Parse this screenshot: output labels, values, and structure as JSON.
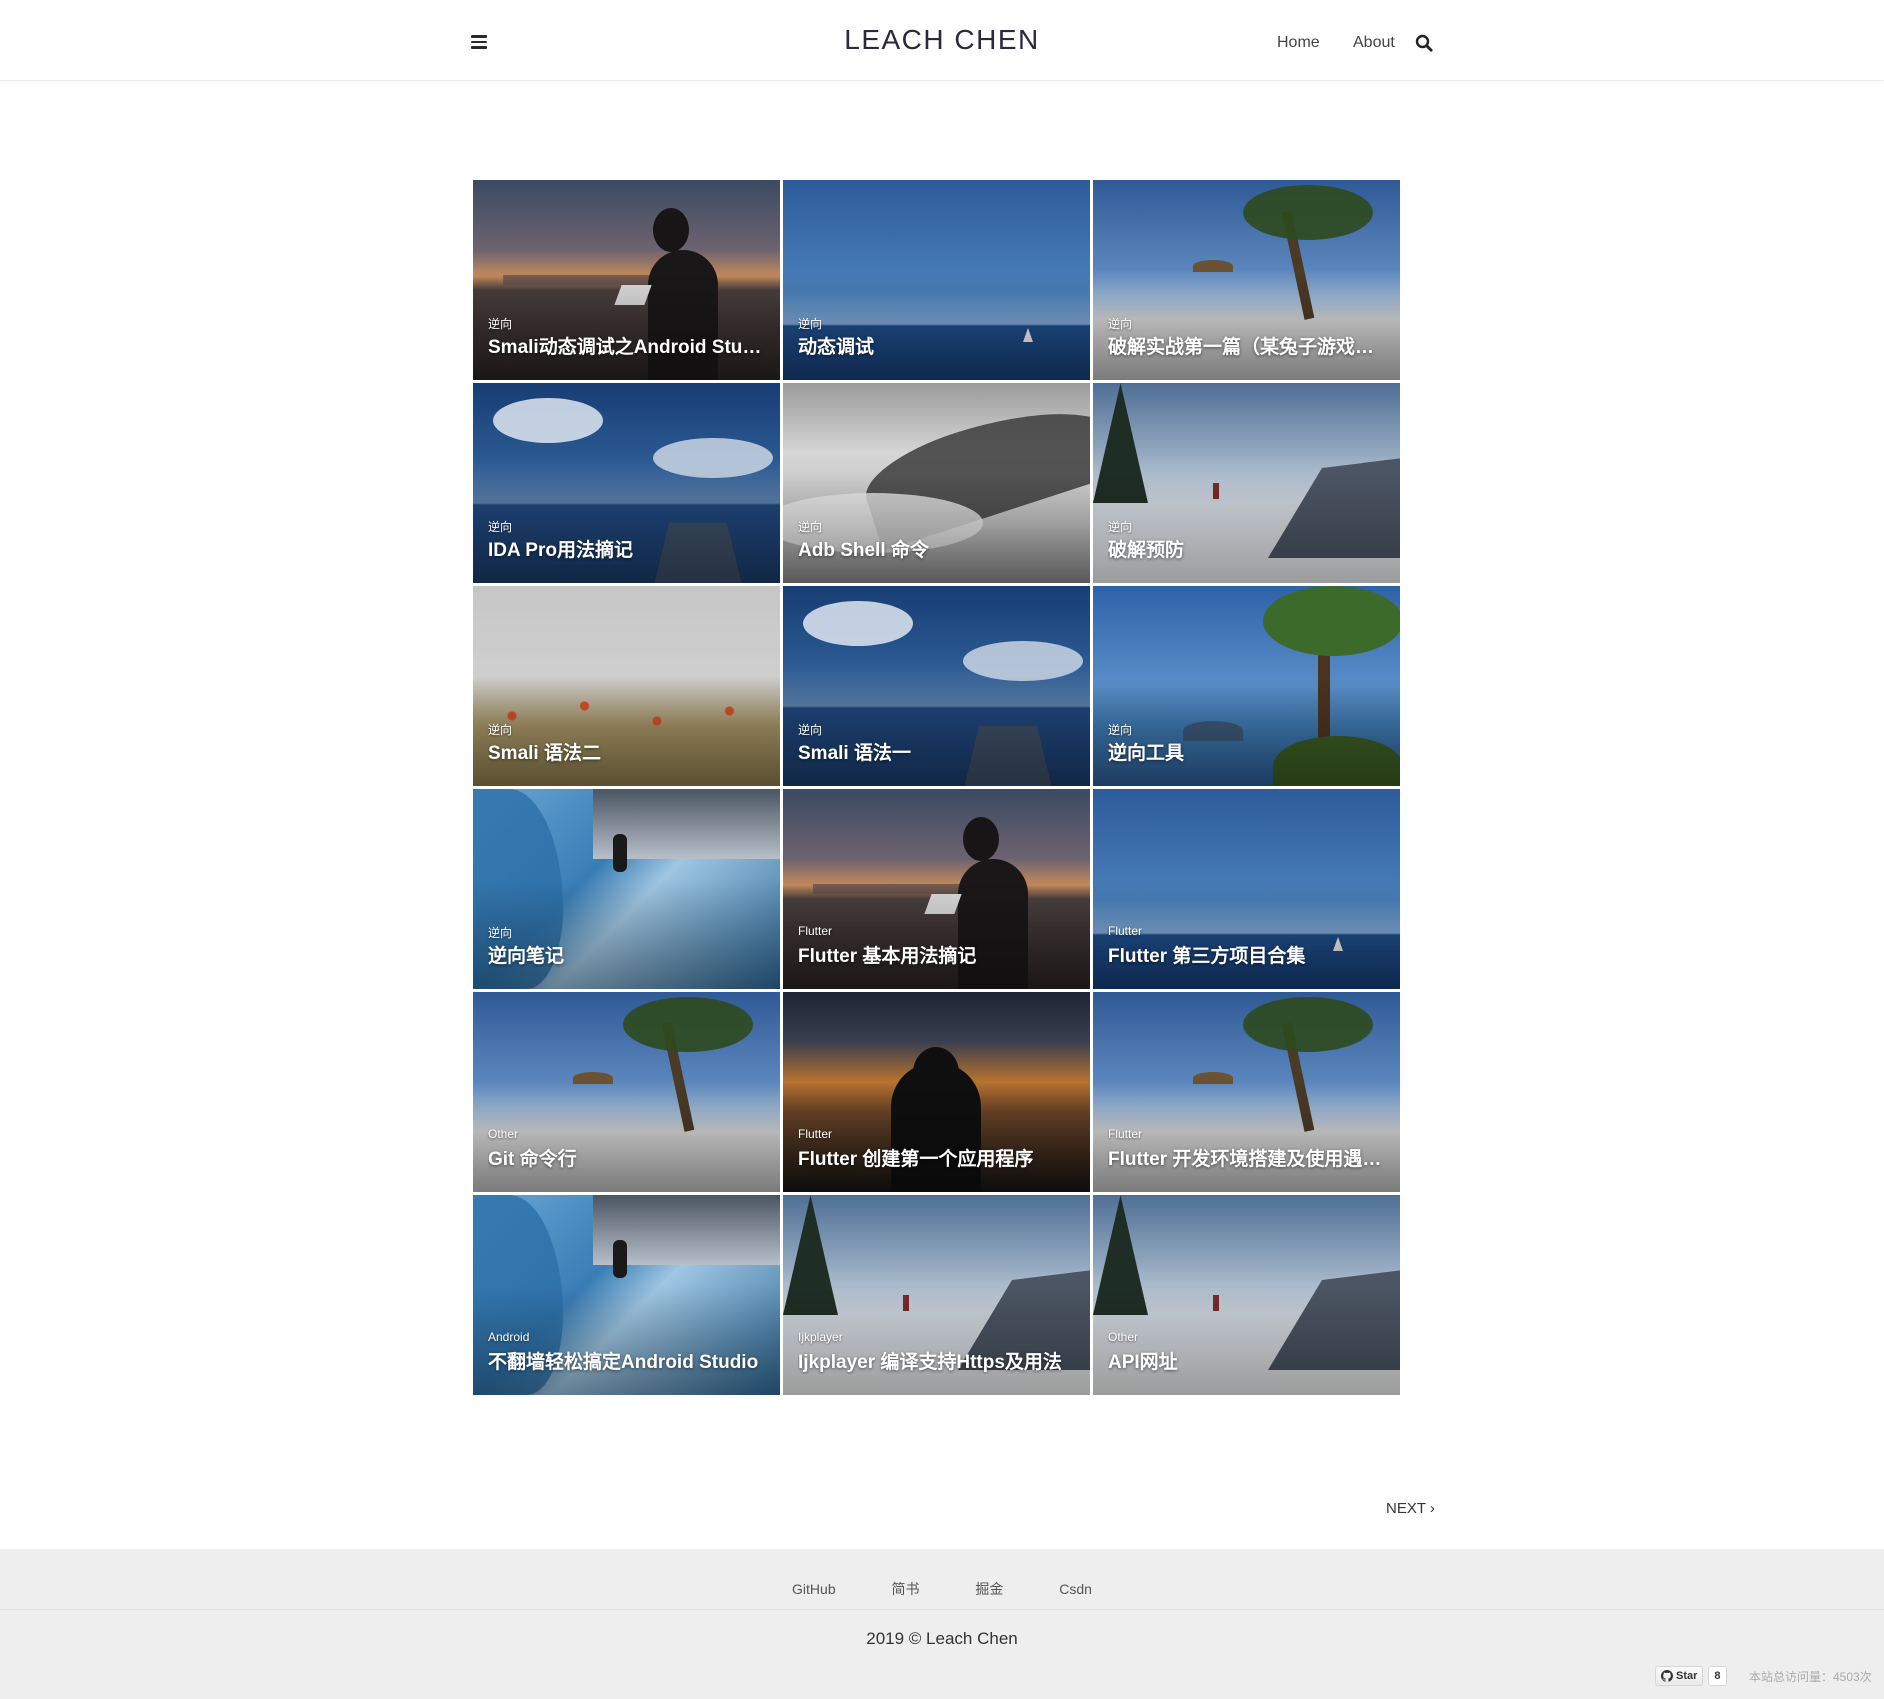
{
  "header": {
    "menu_icon": "hamburger-menu-icon",
    "site_title": "LEACH CHEN",
    "nav": {
      "home": "Home",
      "about": "About"
    },
    "search_icon": "search-icon"
  },
  "posts": [
    {
      "category": "逆向",
      "title": "Smali动态调试之Android Studio",
      "scene": "laptop-sunset"
    },
    {
      "category": "逆向",
      "title": "动态调试",
      "scene": "sea-sail"
    },
    {
      "category": "逆向",
      "title": "破解实战第一篇（某兔子游戏破解）",
      "scene": "beach-palm"
    },
    {
      "category": "逆向",
      "title": "IDA Pro用法摘记",
      "scene": "pier-clouds"
    },
    {
      "category": "逆向",
      "title": "Adb Shell 命令",
      "scene": "misty-forest"
    },
    {
      "category": "逆向",
      "title": "破解预防",
      "scene": "snow-mountain"
    },
    {
      "category": "逆向",
      "title": "Smali 语法二",
      "scene": "poppy-field"
    },
    {
      "category": "逆向",
      "title": "Smali 语法一",
      "scene": "pier-clouds"
    },
    {
      "category": "逆向",
      "title": "逆向工具",
      "scene": "tree-island"
    },
    {
      "category": "逆向",
      "title": "逆向笔记",
      "scene": "ice-climber"
    },
    {
      "category": "Flutter",
      "title": "Flutter 基本用法摘记",
      "scene": "laptop-sunset"
    },
    {
      "category": "Flutter",
      "title": "Flutter 第三方项目合集",
      "scene": "sea-sail"
    },
    {
      "category": "Other",
      "title": "Git 命令行",
      "scene": "beach-palm"
    },
    {
      "category": "Flutter",
      "title": "Flutter 创建第一个应用程序",
      "scene": "sunset-silhouette"
    },
    {
      "category": "Flutter",
      "title": "Flutter 开发环境搭建及使用遇到的问题",
      "scene": "beach-palm"
    },
    {
      "category": "Android",
      "title": "不翻墙轻松搞定Android Studio",
      "scene": "ice-climber"
    },
    {
      "category": "Ijkplayer",
      "title": "Ijkplayer 编译支持Https及用法",
      "scene": "snow-mountain"
    },
    {
      "category": "Other",
      "title": "API网址",
      "scene": "snow-mountain"
    }
  ],
  "pager": {
    "next_label": "NEXT ›"
  },
  "footer": {
    "links": [
      "GitHub",
      "简书",
      "掘金",
      "Csdn"
    ],
    "copyright": "2019 © Leach Chen",
    "github_star": {
      "label": "Star",
      "count": "8",
      "icon": "github-icon"
    },
    "visit_count": "本站总访问量：4503次"
  },
  "colors": {
    "header_bg": "#ffffff",
    "footer_bg": "#eeeeee",
    "title_text": "#2a2a3a",
    "card_text": "#ffffff"
  }
}
